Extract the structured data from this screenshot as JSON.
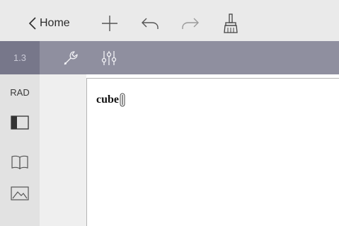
{
  "topbar": {
    "back_label": "Home",
    "icons": [
      "chevron-left-icon",
      "plus-icon",
      "undo-icon",
      "redo-icon",
      "brush-icon"
    ]
  },
  "toolbar": {
    "page_number": "1.3",
    "icons": [
      "wrench-icon",
      "sliders-icon"
    ]
  },
  "sidebar": {
    "angle_mode": "RAD",
    "icons": [
      "panel-icon",
      "book-icon",
      "picture-icon"
    ]
  },
  "editor": {
    "entry_text": "cube"
  },
  "colors": {
    "topbar_bg": "#eaeaea",
    "toolbar_bg": "#8f8f9f",
    "page_num_bg": "#77778a",
    "sidebar_bg": "#e2e2e2",
    "icon_dark": "#2b2b2b",
    "icon_disabled": "#9a9a9a"
  }
}
